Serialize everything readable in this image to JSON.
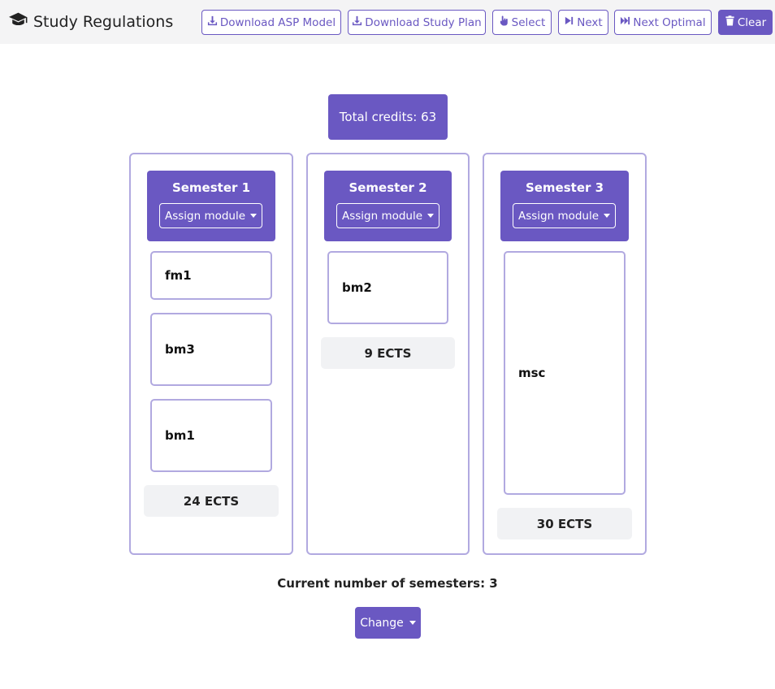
{
  "app": {
    "title": "Study Regulations",
    "icon": "graduation-cap-icon"
  },
  "toolbar": {
    "download_asp": "Download ASP Model",
    "download_plan": "Download Study Plan",
    "select": "Select",
    "next": "Next",
    "next_optimal": "Next Optimal",
    "clear": "Clear"
  },
  "total_credits": "Total credits: 63",
  "semesters": [
    {
      "title": "Semester 1",
      "assign_label": "Assign module",
      "modules": [
        "fm1",
        "bm3",
        "bm1"
      ],
      "ects": "24 ECTS"
    },
    {
      "title": "Semester 2",
      "assign_label": "Assign module",
      "modules": [
        "bm2"
      ],
      "ects": "9 ECTS"
    },
    {
      "title": "Semester 3",
      "assign_label": "Assign module",
      "modules": [
        "msc"
      ],
      "ects": "30 ECTS"
    }
  ],
  "current_semesters": "Current number of semesters: 3",
  "change_label": "Change",
  "colors": {
    "accent": "#6a58c2",
    "border": "#b1a9e0",
    "navbar": "#f4f4f5",
    "ects_bg": "#f1f2f4"
  }
}
